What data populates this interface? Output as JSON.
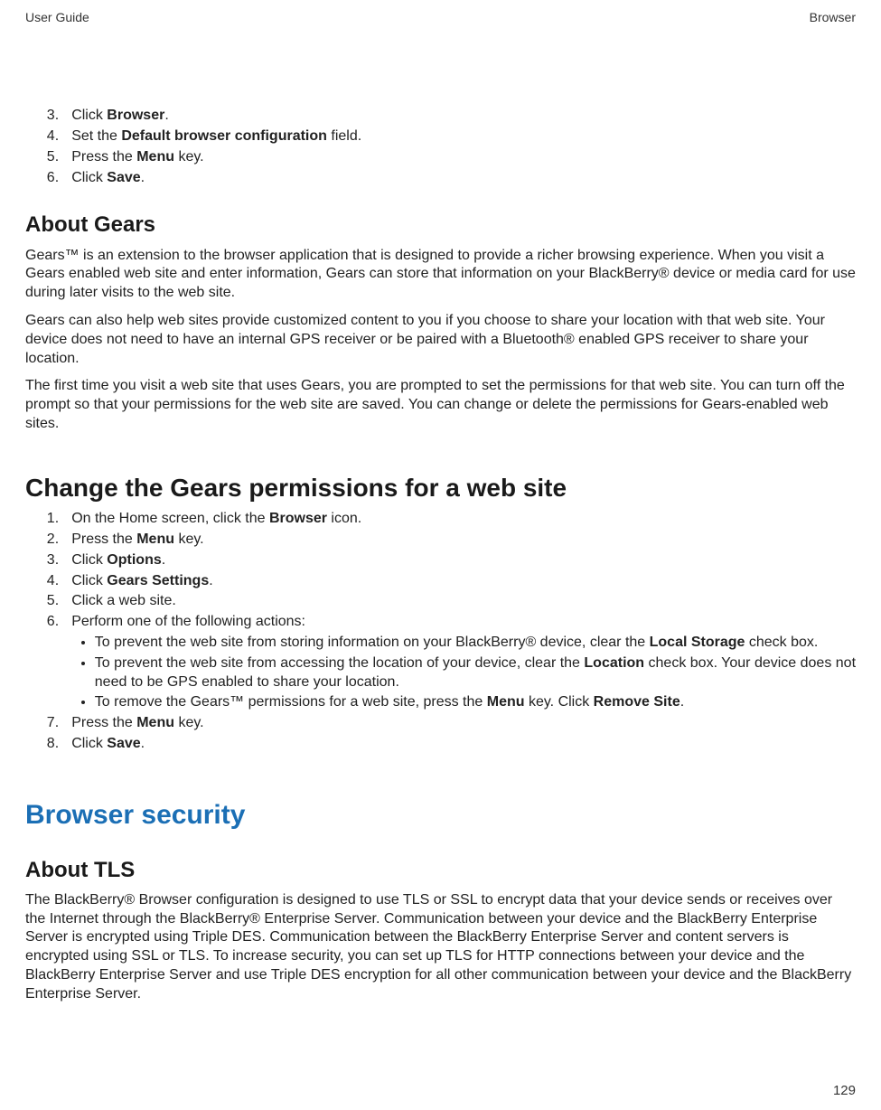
{
  "header": {
    "left": "User Guide",
    "right": "Browser"
  },
  "intro_steps": {
    "start": 3,
    "items": [
      {
        "pre": "Click ",
        "b": "Browser",
        "post": "."
      },
      {
        "pre": "Set the ",
        "b": "Default browser configuration",
        "post": " field."
      },
      {
        "pre": "Press the ",
        "b": "Menu",
        "post": " key."
      },
      {
        "pre": "Click ",
        "b": "Save",
        "post": "."
      }
    ]
  },
  "about_gears": {
    "title": "About Gears",
    "paragraphs": [
      "Gears™ is an extension to the browser application that is designed to provide a richer browsing experience. When you visit a Gears enabled web site and enter information, Gears can store that information on your BlackBerry® device or media card for use during later visits to the web site.",
      "Gears can also help web sites provide customized content to you if you choose to share your location with that web site. Your device does not need to have an internal GPS receiver or be paired with a Bluetooth® enabled GPS receiver to share your location.",
      "The first time you visit a web site that uses Gears, you are prompted to set the permissions for that web site. You can turn off the prompt so that your permissions for the web site are saved. You can change or delete the permissions for Gears-enabled web sites."
    ]
  },
  "change_gears": {
    "title": "Change the Gears permissions for a web site",
    "steps": [
      {
        "pre": "On the Home screen, click the ",
        "b": "Browser",
        "post": " icon."
      },
      {
        "pre": "Press the ",
        "b": "Menu",
        "post": " key."
      },
      {
        "pre": "Click ",
        "b": "Options",
        "post": "."
      },
      {
        "pre": "Click ",
        "b": "Gears Settings",
        "post": "."
      },
      {
        "pre": "Click a web site.",
        "b": "",
        "post": ""
      },
      {
        "pre": "Perform one of the following actions:",
        "b": "",
        "post": "",
        "bullets": [
          {
            "segments": [
              {
                "t": "To prevent the web site from storing information on your BlackBerry® device, clear the "
              },
              {
                "t": "Local Storage",
                "bold": true
              },
              {
                "t": " check box."
              }
            ]
          },
          {
            "segments": [
              {
                "t": "To prevent the web site from accessing the location of your device, clear the "
              },
              {
                "t": "Location",
                "bold": true
              },
              {
                "t": " check box. Your device does not need to be GPS enabled to share your location."
              }
            ]
          },
          {
            "segments": [
              {
                "t": "To remove the Gears™ permissions for a web site, press the "
              },
              {
                "t": "Menu",
                "bold": true
              },
              {
                "t": " key. Click "
              },
              {
                "t": "Remove Site",
                "bold": true
              },
              {
                "t": "."
              }
            ]
          }
        ]
      },
      {
        "pre": "Press the ",
        "b": "Menu",
        "post": " key."
      },
      {
        "pre": "Click ",
        "b": "Save",
        "post": "."
      }
    ]
  },
  "browser_security": {
    "title": "Browser security"
  },
  "about_tls": {
    "title": "About TLS",
    "paragraph": "The BlackBerry® Browser configuration is designed to use TLS or SSL to encrypt data that your device sends or receives over the Internet through the BlackBerry® Enterprise Server. Communication between your device and the BlackBerry Enterprise Server is encrypted using Triple DES. Communication between the BlackBerry Enterprise Server and content servers is encrypted using SSL or TLS. To increase security, you can set up TLS for HTTP connections between your device and the BlackBerry Enterprise Server and use Triple DES encryption for all other communication between your device and the BlackBerry Enterprise Server."
  },
  "page_number": "129"
}
